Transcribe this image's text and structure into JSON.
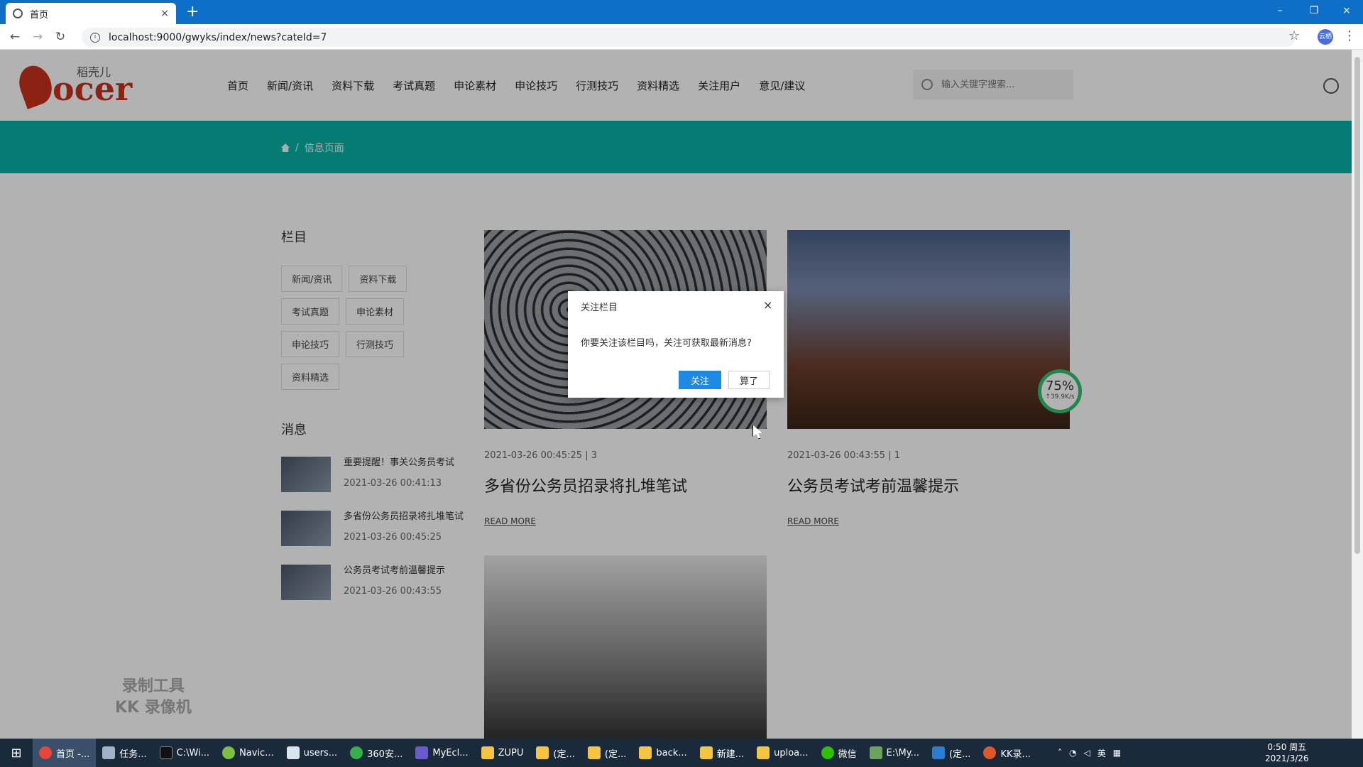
{
  "browser": {
    "tab_title": "首页",
    "tab_close": "×",
    "new_tab": "+",
    "url": "localhost:9000/gwyks/index/news?cateId=7",
    "controls": {
      "minimize": "–",
      "restore": "❐",
      "close": "×"
    },
    "profile": "云栖"
  },
  "header": {
    "logo_text": "ocer",
    "logo_small": "稻壳儿",
    "nav": [
      "首页",
      "新闻/资讯",
      "资料下载",
      "考试真题",
      "申论素材",
      "申论技巧",
      "行测技巧",
      "资料精选",
      "关注用户",
      "意见/建议"
    ],
    "search_placeholder": "输入关键字搜索..."
  },
  "breadcrumb": {
    "current": "信息页面"
  },
  "sidebar": {
    "categories_title": "栏目",
    "categories": [
      "新闻/资讯",
      "资料下载",
      "考试真题",
      "申论素材",
      "申论技巧",
      "行测技巧",
      "资料精选"
    ],
    "messages_title": "消息",
    "messages": [
      {
        "title": "重要提醒！事关公务员考试",
        "date": "2021-03-26 00:41:13"
      },
      {
        "title": "多省份公务员招录将扎堆笔试",
        "date": "2021-03-26 00:45:25"
      },
      {
        "title": "公务员考试考前温馨提示",
        "date": "2021-03-26 00:43:55"
      }
    ]
  },
  "articles": [
    {
      "meta": "2021-03-26 00:45:25 | 3",
      "title": "多省份公务员招录将扎堆笔试",
      "more": "READ MORE"
    },
    {
      "meta": "2021-03-26 00:43:55 | 1",
      "title": "公务员考试考前温馨提示",
      "more": "READ MORE"
    },
    {
      "meta": "",
      "title": "",
      "more": ""
    }
  ],
  "speed_widget": {
    "percent": "75%",
    "rate": "↑39.9K/s"
  },
  "watermark": {
    "line1": "录制工具",
    "line2": "KK 录像机"
  },
  "modal": {
    "title": "关注栏目",
    "close": "×",
    "body": "你要关注该栏目吗，关注可获取最新消息?",
    "confirm": "关注",
    "cancel": "算了"
  },
  "taskbar": {
    "items": [
      "首页 -...",
      "任务...",
      "C:\\Wi...",
      "Navic...",
      "users...",
      "360安...",
      "MyEcl...",
      "ZUPU",
      "(定...",
      "(定...",
      "back...",
      "新建...",
      "uploa...",
      "微信",
      "E:\\My...",
      "(定...",
      "KK录..."
    ],
    "tray_lang": "英",
    "clock_time": "0:50 周五",
    "clock_date": "2021/3/26"
  },
  "colors": {
    "teal": "#0ab0a6",
    "brand_red": "#c9321e",
    "primary_blue": "#1e88e5"
  }
}
